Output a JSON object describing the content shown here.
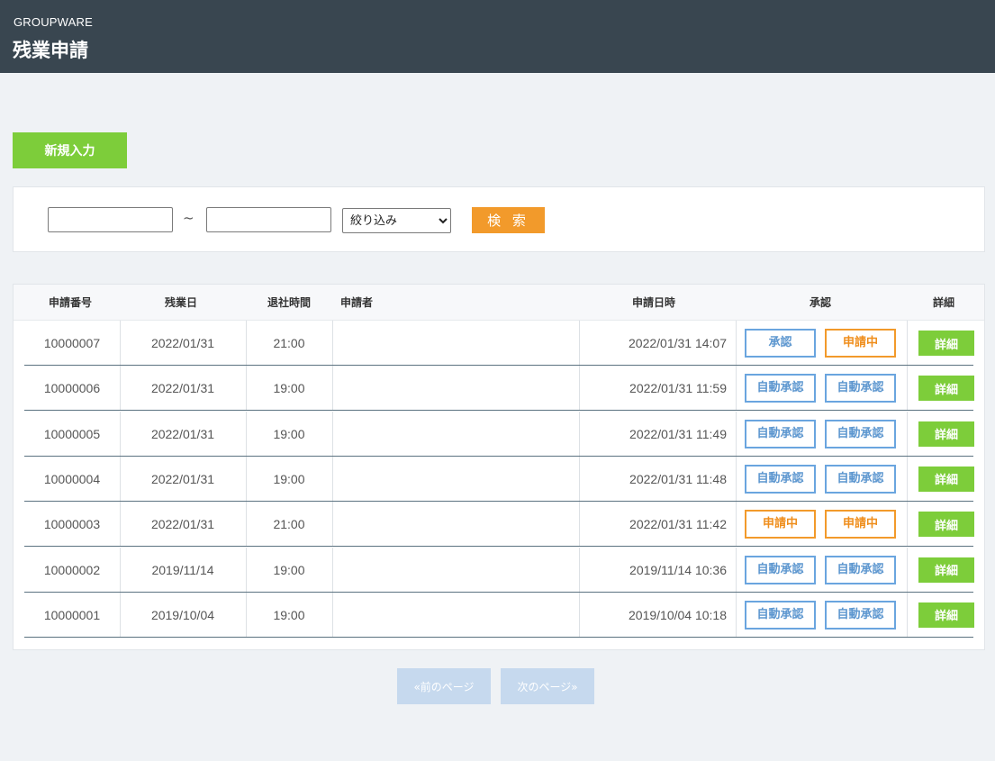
{
  "header": {
    "app_name": "GROUPWARE",
    "title": "残業申請"
  },
  "toolbar": {
    "new_label": "新規入力"
  },
  "search": {
    "date_from": "",
    "date_to": "",
    "separator": "~",
    "filter_selected": "絞り込み",
    "search_label": "検 索"
  },
  "table": {
    "headers": {
      "no": "申請番号",
      "date": "残業日",
      "leave_time": "退社時間",
      "applicant": "申請者",
      "request_datetime": "申請日時",
      "approval": "承認",
      "detail": "詳細"
    },
    "rows": [
      {
        "no": "10000007",
        "date": "2022/01/31",
        "leave_time": "21:00",
        "applicant": "",
        "request_datetime": "2022/01/31 14:07",
        "approval1": "承認",
        "approval1_status": "blue",
        "approval2": "申請中",
        "approval2_status": "orange",
        "detail": "詳細"
      },
      {
        "no": "10000006",
        "date": "2022/01/31",
        "leave_time": "19:00",
        "applicant": "",
        "request_datetime": "2022/01/31 11:59",
        "approval1": "自動承認",
        "approval1_status": "blue",
        "approval2": "自動承認",
        "approval2_status": "blue",
        "detail": "詳細"
      },
      {
        "no": "10000005",
        "date": "2022/01/31",
        "leave_time": "19:00",
        "applicant": "",
        "request_datetime": "2022/01/31 11:49",
        "approval1": "自動承認",
        "approval1_status": "blue",
        "approval2": "自動承認",
        "approval2_status": "blue",
        "detail": "詳細"
      },
      {
        "no": "10000004",
        "date": "2022/01/31",
        "leave_time": "19:00",
        "applicant": "",
        "request_datetime": "2022/01/31 11:48",
        "approval1": "自動承認",
        "approval1_status": "blue",
        "approval2": "自動承認",
        "approval2_status": "blue",
        "detail": "詳細"
      },
      {
        "no": "10000003",
        "date": "2022/01/31",
        "leave_time": "21:00",
        "applicant": "",
        "request_datetime": "2022/01/31 11:42",
        "approval1": "申請中",
        "approval1_status": "orange",
        "approval2": "申請中",
        "approval2_status": "orange",
        "detail": "詳細"
      },
      {
        "no": "10000002",
        "date": "2019/11/14",
        "leave_time": "19:00",
        "applicant": "",
        "request_datetime": "2019/11/14 10:36",
        "approval1": "自動承認",
        "approval1_status": "blue",
        "approval2": "自動承認",
        "approval2_status": "blue",
        "detail": "詳細"
      },
      {
        "no": "10000001",
        "date": "2019/10/04",
        "leave_time": "19:00",
        "applicant": "",
        "request_datetime": "2019/10/04 10:18",
        "approval1": "自動承認",
        "approval1_status": "blue",
        "approval2": "自動承認",
        "approval2_status": "blue",
        "detail": "詳細"
      }
    ]
  },
  "pager": {
    "prev_label": "«前のページ",
    "next_label": "次のページ»"
  },
  "colors": {
    "header_bg": "#394650",
    "page_bg": "#eff2f5",
    "green": "#7dcd3a",
    "orange": "#f29a2b",
    "blue": "#6aa5df",
    "pager_disabled": "#c6d9ee"
  }
}
